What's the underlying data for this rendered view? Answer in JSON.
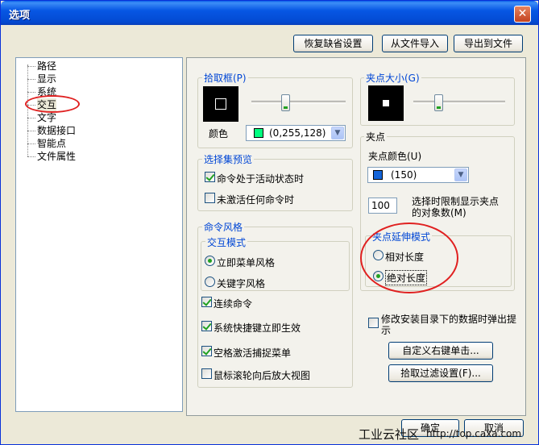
{
  "window": {
    "title": "选项",
    "close_glyph": "✕"
  },
  "top_buttons": {
    "restore": "恢复缺省设置",
    "import": "从文件导入",
    "export": "导出到文件"
  },
  "tree": {
    "items": [
      "路径",
      "显示",
      "系统",
      "交互",
      "文字",
      "数据接口",
      "智能点",
      "文件属性"
    ],
    "selected": "交互"
  },
  "pickbox": {
    "group_label": "拾取框(P)",
    "color_label": "颜色",
    "color_value": "(0,255,128)",
    "color_swatch": "#00ff80",
    "slider_level": 0.35
  },
  "selection_preview": {
    "group_label": "选择集预览",
    "active_cmd": {
      "label": "命令处于活动状态时",
      "checked": true
    },
    "no_cmd": {
      "label": "未激活任何命令时",
      "checked": false
    }
  },
  "command_style": {
    "group_label": "命令风格",
    "interaction_mode_label": "交互模式",
    "menu_style": {
      "label": "立即菜单风格",
      "selected": true
    },
    "keyword_style": {
      "label": "关键字风格",
      "selected": false
    },
    "continuous": {
      "label": "连续命令",
      "checked": true
    },
    "shortcut": {
      "label": "系统快捷键立即生效",
      "checked": true
    },
    "space_snap": {
      "label": "空格激活捕捉菜单",
      "checked": true
    },
    "wheel_zoom": {
      "label": "鼠标滚轮向后放大视图",
      "checked": false
    }
  },
  "grip_size": {
    "group_label": "夹点大小(G)",
    "slider_level": 0.25
  },
  "grips": {
    "group_label": "夹点",
    "color_label": "夹点颜色(U)",
    "color_value": "(150)",
    "color_swatch": "#1464d8",
    "limit_value": "100",
    "limit_label_line1": "选择时限制显示夹点",
    "limit_label_line2": "的对象数(M)"
  },
  "grip_stretch": {
    "group_label": "夹点延伸模式",
    "relative": {
      "label": "相对长度",
      "selected": false
    },
    "absolute": {
      "label": "绝对长度",
      "selected": true
    }
  },
  "misc": {
    "popup_label_line1": "修改安装目录下的数据时弹出提",
    "popup_label_line2": "示",
    "popup_checked": false,
    "custom_right_click": "自定义右键单击...",
    "pick_filter": "拾取过滤设置(F)..."
  },
  "bottom_buttons": {
    "ok": "确定",
    "cancel": "取消"
  },
  "watermark": {
    "text": "工业云社区",
    "url": "http://top.caxa.com"
  },
  "colors": {
    "annotation_red": "#e02020",
    "title_blue": "#0a5fe8"
  }
}
